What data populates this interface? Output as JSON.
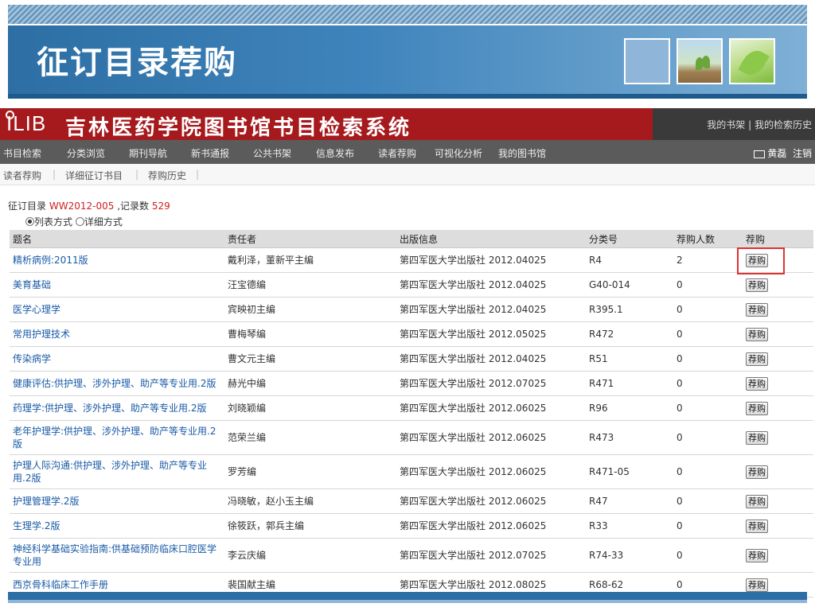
{
  "slide": {
    "title": "征订目录荐购"
  },
  "library": {
    "logo": "ILIB",
    "title": "吉林医药学院图书馆书目检索系统",
    "top_links": {
      "shelf": "我的书架",
      "sep": " | ",
      "history": "我的检索历史"
    }
  },
  "nav": {
    "items": [
      "书目检索",
      "分类浏览",
      "期刊导航",
      "新书通报",
      "公共书架",
      "信息发布",
      "读者荐购",
      "可视化分析",
      "我的图书馆"
    ],
    "user": "黄磊",
    "logout": "注销"
  },
  "subnav": {
    "items": [
      "读者荐购",
      "详细征订书目",
      "荐购历史"
    ]
  },
  "catalog": {
    "prefix": "征订目录",
    "code": "WW2012-005",
    "count_label": ",记录数",
    "count": "529",
    "mode_list": "列表方式",
    "mode_detail": "详细方式",
    "selected_mode": "列表方式"
  },
  "table": {
    "headers": [
      "题名",
      "责任者",
      "出版信息",
      "分类号",
      "荐购人数",
      "荐购"
    ],
    "button_label": "荐购",
    "rows": [
      {
        "title": "精析病例:2011版",
        "author": "戴利泽，董新平主编",
        "pub": "第四军医大学出版社 2012.04025",
        "cls": "R4",
        "count": "2"
      },
      {
        "title": "美育基础",
        "author": "汪宝德编",
        "pub": "第四军医大学出版社 2012.04025",
        "cls": "G40-014",
        "count": "0"
      },
      {
        "title": "医学心理学",
        "author": "宾映初主编",
        "pub": "第四军医大学出版社 2012.04025",
        "cls": "R395.1",
        "count": "0"
      },
      {
        "title": "常用护理技术",
        "author": "曹梅琴编",
        "pub": "第四军医大学出版社 2012.05025",
        "cls": "R472",
        "count": "0"
      },
      {
        "title": "传染病学",
        "author": "曹文元主编",
        "pub": "第四军医大学出版社 2012.04025",
        "cls": "R51",
        "count": "0"
      },
      {
        "title": "健康评估:供护理、涉外护理、助产等专业用.2版",
        "author": "赫光中编",
        "pub": "第四军医大学出版社 2012.07025",
        "cls": "R471",
        "count": "0"
      },
      {
        "title": "药理学:供护理、涉外护理、助产等专业用.2版",
        "author": "刘晓颖编",
        "pub": "第四军医大学出版社 2012.06025",
        "cls": "R96",
        "count": "0"
      },
      {
        "title": "老年护理学:供护理、涉外护理、助产等专业用.2版",
        "author": "范荣兰编",
        "pub": "第四军医大学出版社 2012.06025",
        "cls": "R473",
        "count": "0"
      },
      {
        "title": "护理人际沟通:供护理、涉外护理、助产等专业用.2版",
        "author": "罗芳编",
        "pub": "第四军医大学出版社 2012.06025",
        "cls": "R471-05",
        "count": "0"
      },
      {
        "title": "护理管理学.2版",
        "author": "冯晓敏，赵小玉主编",
        "pub": "第四军医大学出版社 2012.06025",
        "cls": "R47",
        "count": "0"
      },
      {
        "title": "生理学.2版",
        "author": "徐筱跃，郭兵主编",
        "pub": "第四军医大学出版社 2012.06025",
        "cls": "R33",
        "count": "0"
      },
      {
        "title": "神经科学基础实验指南:供基础预防临床口腔医学专业用",
        "author": "李云庆编",
        "pub": "第四军医大学出版社 2012.07025",
        "cls": "R74-33",
        "count": "0"
      },
      {
        "title": "西京骨科临床工作手册",
        "author": "裴国献主编",
        "pub": "第四军医大学出版社 2012.08025",
        "cls": "R68-62",
        "count": "0"
      }
    ]
  }
}
